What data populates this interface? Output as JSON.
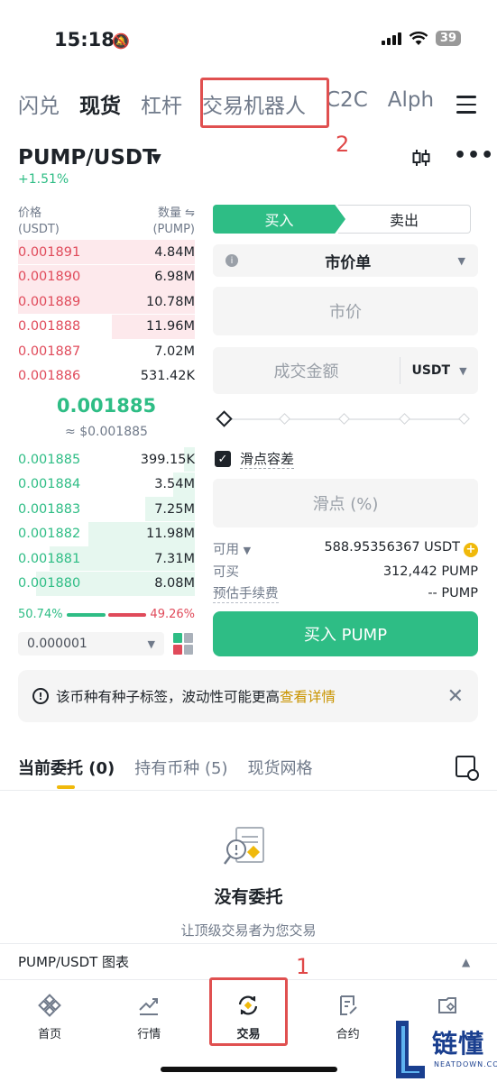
{
  "status_bar": {
    "time": "15:18",
    "battery": "39"
  },
  "top_nav": {
    "tabs": [
      {
        "label": "闪兑",
        "active": false
      },
      {
        "label": "现货",
        "active": true
      },
      {
        "label": "杠杆",
        "active": false
      },
      {
        "label": "交易机器人",
        "active": false
      },
      {
        "label": "C2C",
        "active": false
      },
      {
        "label": "Alph",
        "active": false
      }
    ]
  },
  "annotations": {
    "top": "2",
    "bottom": "1"
  },
  "pair": {
    "symbol": "PUMP/USDT",
    "change": "+1.51%"
  },
  "order_book": {
    "price_header": "价格",
    "price_unit": "(USDT)",
    "qty_header": "数量 ⇋",
    "qty_unit": "(PUMP)",
    "asks": [
      {
        "price": "0.001891",
        "qty": "4.84M",
        "depth": 1.0
      },
      {
        "price": "0.001890",
        "qty": "6.98M",
        "depth": 1.0
      },
      {
        "price": "0.001889",
        "qty": "10.78M",
        "depth": 1.0
      },
      {
        "price": "0.001888",
        "qty": "11.96M",
        "depth": 0.47
      },
      {
        "price": "0.001887",
        "qty": "7.02M",
        "depth": 0.0
      },
      {
        "price": "0.001886",
        "qty": "531.42K",
        "depth": 0.0
      }
    ],
    "last_price": "0.001885",
    "last_price_usd": "≈ $0.001885",
    "bids": [
      {
        "price": "0.001885",
        "qty": "399.15K",
        "depth": 0.06
      },
      {
        "price": "0.001884",
        "qty": "3.54M",
        "depth": 0.12
      },
      {
        "price": "0.001883",
        "qty": "7.25M",
        "depth": 0.28
      },
      {
        "price": "0.001882",
        "qty": "11.98M",
        "depth": 0.6
      },
      {
        "price": "0.001881",
        "qty": "7.31M",
        "depth": 0.82
      },
      {
        "price": "0.001880",
        "qty": "8.08M",
        "depth": 0.9
      }
    ],
    "buy_ratio": "50.74%",
    "sell_ratio": "49.26%",
    "buy_ratio_value": 50.74,
    "precision": "0.000001"
  },
  "trade_form": {
    "buy_label": "买入",
    "sell_label": "卖出",
    "order_type": "市价单",
    "price_placeholder": "市价",
    "amount_placeholder": "成交金额",
    "amount_unit": "USDT",
    "slippage_check_label": "滑点容差",
    "slippage_placeholder": "滑点 (%)",
    "available_label": "可用",
    "available_value": "588.95356367 USDT",
    "can_buy_label": "可买",
    "can_buy_value": "312,442 PUMP",
    "fee_label": "预估手续费",
    "fee_value": "-- PUMP",
    "submit_label": "买入 PUMP"
  },
  "notice": {
    "text": "该币种有种子标签，波动性可能更高",
    "link": "查看详情"
  },
  "order_tabs": [
    {
      "label": "当前委托 (0)",
      "active": true
    },
    {
      "label": "持有币种 (5)",
      "active": false
    },
    {
      "label": "现货网格",
      "active": false
    }
  ],
  "empty_state": {
    "title": "没有委托",
    "subtitle": "让顶级交易者为您交易"
  },
  "chart_bar": {
    "label": "PUMP/USDT 图表"
  },
  "bottom_nav": [
    {
      "label": "首页",
      "icon": "home-icon"
    },
    {
      "label": "行情",
      "icon": "market-chart-icon"
    },
    {
      "label": "交易",
      "icon": "trade-icon"
    },
    {
      "label": "合约",
      "icon": "futures-icon"
    },
    {
      "label": "",
      "icon": "wallet-icon"
    }
  ],
  "watermark": {
    "text": "链懂",
    "sub": "NEATDOWN.COM"
  },
  "colors": {
    "green": "#2ebd85",
    "red": "#e04a5a",
    "yellow": "#f0b90b",
    "annotation": "#e05050"
  }
}
